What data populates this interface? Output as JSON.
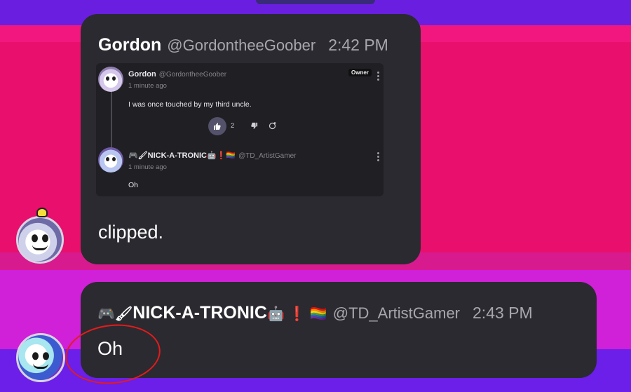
{
  "messages": [
    {
      "name": "Gordon",
      "handle": "@GordontheeGoober",
      "time": "2:42 PM",
      "text": "clipped.",
      "embed": {
        "comment": {
          "name": "Gordon",
          "handle": "@GordontheeGoober",
          "ago": "1 minute ago",
          "badge": "Owner",
          "text": "I was once touched by my third uncle.",
          "likes": "2"
        },
        "reply": {
          "name": "🎮🖌NICK-A-TRONIC🤖❗🏳️‍🌈",
          "handle": "@TD_ArtistGamer",
          "ago": "1 minute ago",
          "text": "Oh"
        }
      }
    },
    {
      "name_prefix": "🎮🖌",
      "name": "NICK-A-TRONIC",
      "name_suffix": "🤖 ❗ 🏳️‍🌈",
      "handle": "@TD_ArtistGamer",
      "time": "2:43 PM",
      "text": "Oh"
    }
  ],
  "icons": {
    "like": "thumbs-up-icon",
    "dislike": "thumbs-down-icon",
    "reply": "reply-icon",
    "more": "more-vertical-icon"
  }
}
